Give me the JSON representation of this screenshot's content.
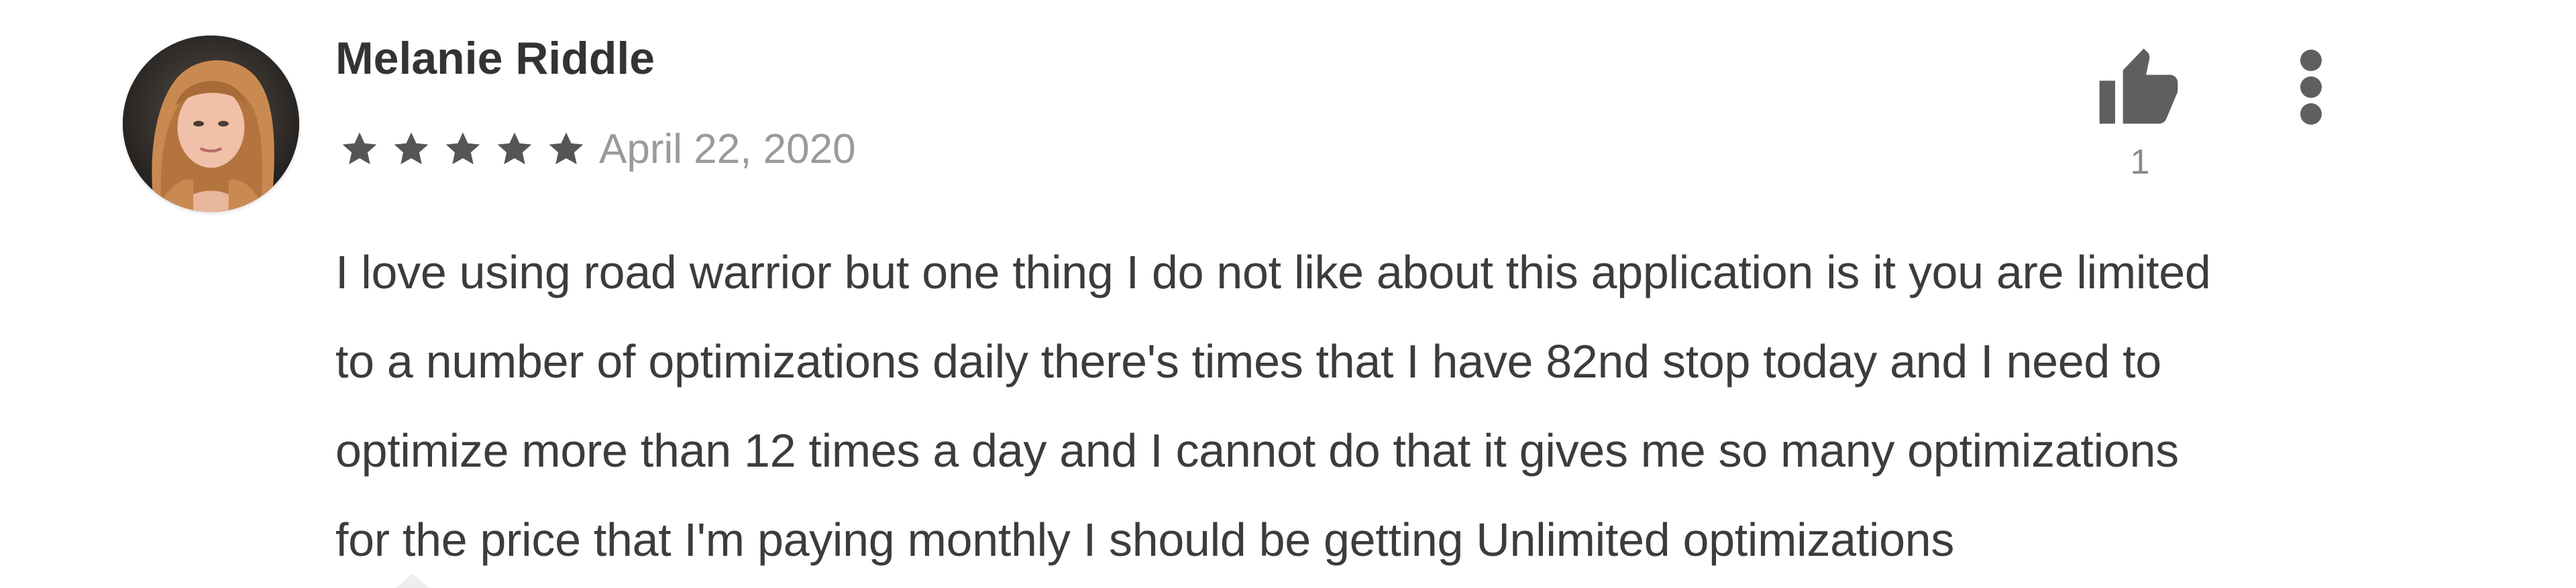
{
  "review": {
    "author": "Melanie Riddle",
    "rating": 5,
    "rating_max": 5,
    "date": "April 22, 2020",
    "lines": [
      "I love using road warrior but one thing I do not like about this application is it you are limited",
      "to a number of optimizations daily there's times that I have 82nd stop today and I need to",
      "optimize more than 12 times a day and I cannot do that it gives me so many optimizations",
      "for the price that I'm paying monthly I should be getting Unlimited optimizations"
    ],
    "helpful_count": "1"
  },
  "icons": {
    "helpful": "thumbs-up-icon",
    "menu": "more-vertical-icon",
    "star": "star-icon"
  },
  "colors": {
    "star": "#555555",
    "icon": "#5f5f5f",
    "date": "#9a9a9a"
  }
}
